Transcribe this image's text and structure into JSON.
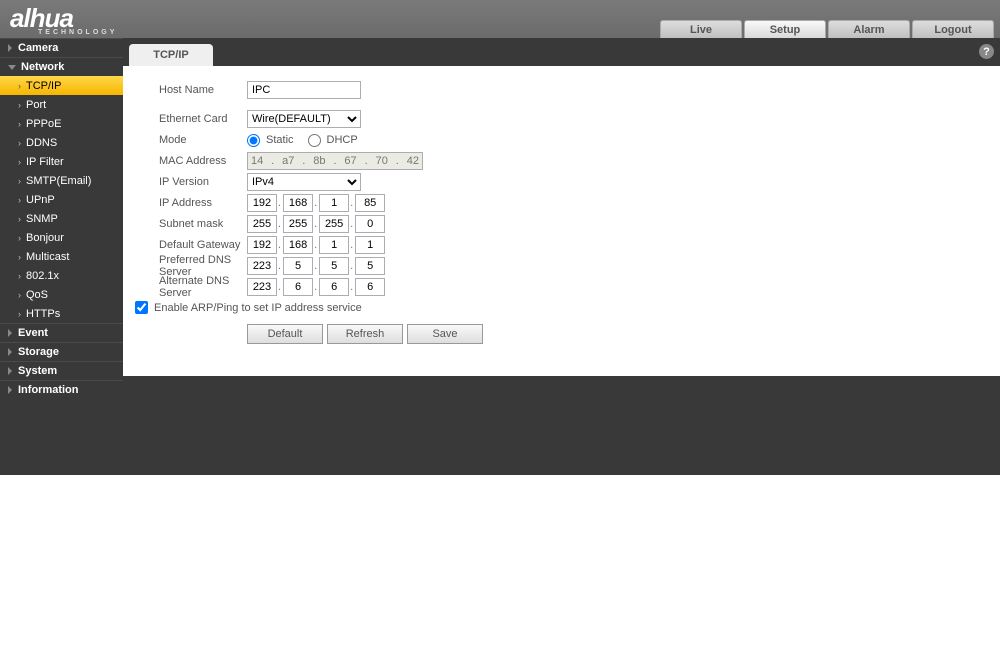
{
  "brand": {
    "name": "alhua",
    "sub": "TECHNOLOGY"
  },
  "top_tabs": {
    "live": "Live",
    "setup": "Setup",
    "alarm": "Alarm",
    "logout": "Logout"
  },
  "sidebar": {
    "camera": "Camera",
    "network": "Network",
    "network_items": [
      "TCP/IP",
      "Port",
      "PPPoE",
      "DDNS",
      "IP Filter",
      "SMTP(Email)",
      "UPnP",
      "SNMP",
      "Bonjour",
      "Multicast",
      "802.1x",
      "QoS",
      "HTTPs"
    ],
    "event": "Event",
    "storage": "Storage",
    "system": "System",
    "information": "Information"
  },
  "tab": "TCP/IP",
  "help": "?",
  "form": {
    "host_name_lbl": "Host Name",
    "host_name": "IPC",
    "eth_card_lbl": "Ethernet Card",
    "eth_card": "Wire(DEFAULT)",
    "mode_lbl": "Mode",
    "mode_static": "Static",
    "mode_dhcp": "DHCP",
    "mac_lbl": "MAC Address",
    "mac": [
      "14",
      "a7",
      "8b",
      "67",
      "70",
      "42"
    ],
    "ipver_lbl": "IP Version",
    "ipver": "IPv4",
    "ipaddr_lbl": "IP Address",
    "ipaddr": [
      "192",
      "168",
      "1",
      "85"
    ],
    "subnet_lbl": "Subnet mask",
    "subnet": [
      "255",
      "255",
      "255",
      "0"
    ],
    "gw_lbl": "Default Gateway",
    "gw": [
      "192",
      "168",
      "1",
      "1"
    ],
    "dns1_lbl": "Preferred DNS Server",
    "dns1": [
      "223",
      "5",
      "5",
      "5"
    ],
    "dns2_lbl": "Alternate DNS Server",
    "dns2": [
      "223",
      "6",
      "6",
      "6"
    ],
    "arp_lbl": "Enable ARP/Ping to set IP address service",
    "default_btn": "Default",
    "refresh_btn": "Refresh",
    "save_btn": "Save"
  }
}
